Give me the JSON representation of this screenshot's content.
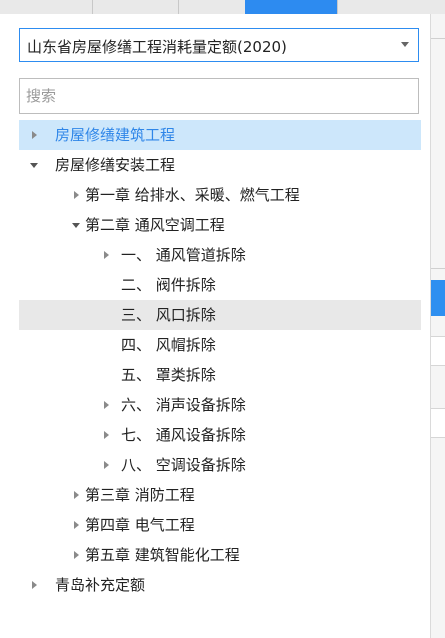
{
  "selector": {
    "value": "山东省房屋修缮工程消耗量定额(2020)"
  },
  "search": {
    "placeholder": "搜索"
  },
  "tree": [
    {
      "label": "房屋修缮建筑工程",
      "level": 0,
      "arrow": "right",
      "state": "selected"
    },
    {
      "label": "房屋修缮安装工程",
      "level": 0,
      "arrow": "down"
    },
    {
      "label": "第一章 给排水、采暖、燃气工程",
      "level": 1,
      "arrow": "right"
    },
    {
      "label": "第二章 通风空调工程",
      "level": 1,
      "arrow": "down"
    },
    {
      "label": "一、 通风管道拆除",
      "level": 2,
      "arrow": "right"
    },
    {
      "label": "二、 阀件拆除",
      "level": 2,
      "arrow": "none"
    },
    {
      "label": "三、 风口拆除",
      "level": 2,
      "arrow": "none",
      "state": "hover"
    },
    {
      "label": "四、 风帽拆除",
      "level": 2,
      "arrow": "none"
    },
    {
      "label": "五、 罩类拆除",
      "level": 2,
      "arrow": "none"
    },
    {
      "label": "六、 消声设备拆除",
      "level": 2,
      "arrow": "right"
    },
    {
      "label": "七、 通风设备拆除",
      "level": 2,
      "arrow": "right"
    },
    {
      "label": "八、 空调设备拆除",
      "level": 2,
      "arrow": "right"
    },
    {
      "label": "第三章 消防工程",
      "level": 1,
      "arrow": "right"
    },
    {
      "label": "第四章 电气工程",
      "level": 1,
      "arrow": "right"
    },
    {
      "label": "第五章 建筑智能化工程",
      "level": 1,
      "arrow": "right"
    },
    {
      "label": "青岛补充定额",
      "level": 0,
      "arrow": "right"
    }
  ]
}
